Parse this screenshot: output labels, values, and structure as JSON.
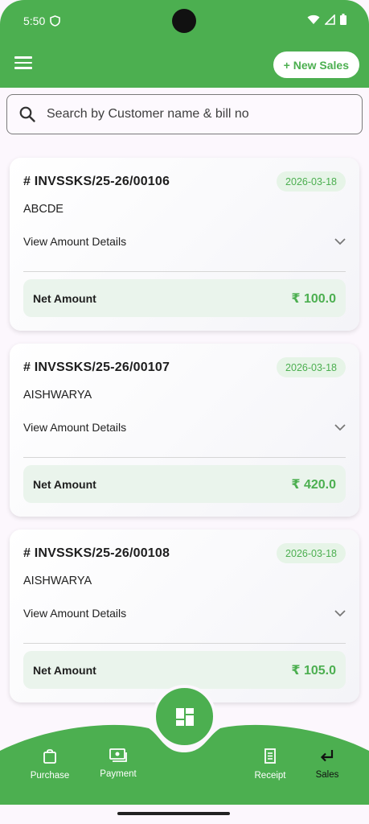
{
  "status_bar": {
    "time": "5:50"
  },
  "app_bar": {
    "new_sales_label": "+ New Sales"
  },
  "search": {
    "placeholder": "Search by Customer name & bill no"
  },
  "invoices": [
    {
      "bill_no": "# INVSSKS/25-26/00106",
      "date": "2026-03-18",
      "customer": "ABCDE",
      "details_label": "View Amount Details",
      "net_label": "Net Amount",
      "net_amount": "₹ 100.0"
    },
    {
      "bill_no": "# INVSSKS/25-26/00107",
      "date": "2026-03-18",
      "customer": "AISHWARYA",
      "details_label": "View Amount Details",
      "net_label": "Net Amount",
      "net_amount": "₹ 420.0"
    },
    {
      "bill_no": "# INVSSKS/25-26/00108",
      "date": "2026-03-18",
      "customer": "AISHWARYA",
      "details_label": "View Amount Details",
      "net_label": "Net Amount",
      "net_amount": "₹ 105.0"
    }
  ],
  "bottom_nav": {
    "purchase": "Purchase",
    "payment": "Payment",
    "receipt": "Receipt",
    "sales": "Sales"
  },
  "colors": {
    "accent": "#4caf50",
    "badge_bg": "#e6f4e7",
    "net_bg": "#eaf4ec"
  }
}
